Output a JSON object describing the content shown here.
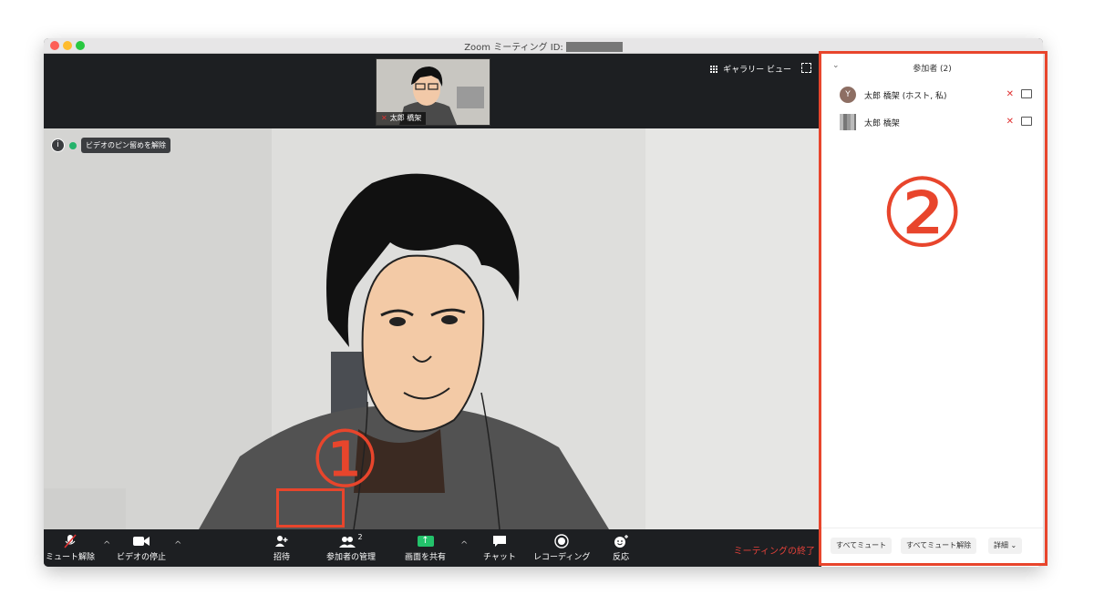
{
  "window": {
    "title": "Zoom ミーティング ID:",
    "traffic_lights": [
      "close",
      "minimize",
      "maximize"
    ]
  },
  "top_strip": {
    "thumbnail_name": "太郎 橋架",
    "gallery_view_label": "ギャラリー ビュー"
  },
  "video": {
    "unpin_label": "ビデオのピン留めを解除"
  },
  "toolbar": {
    "unmute_label": "ミュート解除",
    "stop_video_label": "ビデオの停止",
    "invite_label": "招待",
    "manage_participants_label": "参加者の管理",
    "participant_count": "2",
    "share_screen_label": "画面を共有",
    "chat_label": "チャット",
    "recording_label": "レコーディング",
    "reactions_label": "反応",
    "end_meeting_label": "ミーティングの終了"
  },
  "participants_panel": {
    "header": "参加者 (2)",
    "participants": [
      {
        "avatar_letter": "Y",
        "name": "太郎 橋架 (ホスト, 私)"
      },
      {
        "avatar_letter": "",
        "name": "太郎 橋架"
      }
    ],
    "footer": {
      "mute_all": "すべてミュート",
      "unmute_all": "すべてミュート解除",
      "more": "詳細"
    }
  },
  "annotations": {
    "marker_1": "①",
    "marker_2": "②",
    "highlight_color": "#e8452c"
  },
  "colors": {
    "end_meeting": "#e5413a",
    "share_green": "#23c26b",
    "toolbar_bg": "#1d1f22"
  }
}
